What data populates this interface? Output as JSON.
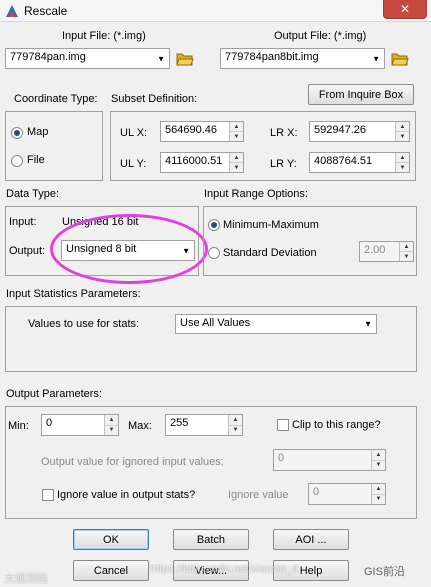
{
  "window": {
    "title": "Rescale",
    "close_glyph": "✕"
  },
  "input_file": {
    "label": "Input File: (*.img)",
    "value": "779784pan.img"
  },
  "output_file": {
    "label": "Output File: (*.img)",
    "value": "779784pan8bit.img"
  },
  "from_inquire_box": "From Inquire Box",
  "coordinate_type": {
    "label": "Coordinate Type:",
    "map": "Map",
    "file": "File",
    "selected": "Map"
  },
  "subset": {
    "label": "Subset Definition:",
    "ulx_label": "UL X:",
    "ulx": "564690.46",
    "uly_label": "UL Y:",
    "uly": "4116000.51",
    "lrx_label": "LR X:",
    "lrx": "592947.26",
    "lry_label": "LR Y:",
    "lry": "4088764.51"
  },
  "data_type": {
    "label": "Data Type:",
    "input_label": "Input:",
    "input_value": "Unsigned 16 bit",
    "output_label": "Output:",
    "output_value": "Unsigned 8 bit"
  },
  "input_range": {
    "label": "Input Range Options:",
    "minmax": "Minimum-Maximum",
    "stddev": "Standard Deviation",
    "stddev_value": "2.00",
    "selected": "Minimum-Maximum"
  },
  "input_stats": {
    "label": "Input Statistics Parameters:",
    "values_label": "Values to use for stats:",
    "values_value": "Use All Values"
  },
  "output_params": {
    "label": "Output Parameters:",
    "min_label": "Min:",
    "min_value": "0",
    "max_label": "Max:",
    "max_value": "255",
    "clip_label": "Clip to this range?",
    "ignored_label": "Output value for ignored input values:",
    "ignored_value": "0",
    "ignore_stats_label": "Ignore value in output stats?",
    "ignore_value_label": "Ignore value",
    "ignore_value": "0"
  },
  "buttons": {
    "ok": "OK",
    "batch": "Batch",
    "aoi": "AOI ...",
    "cancel": "Cancel",
    "view": "View...",
    "help": "Help"
  },
  "watermarks": {
    "left": "大观测绘",
    "center": "https://blog.csdn.net/xiaoxin_4",
    "right": "GIS前沿"
  },
  "colors": {
    "highlight": "#e040e0",
    "close_button": "#c64a3e",
    "folder": "#e0b020"
  }
}
